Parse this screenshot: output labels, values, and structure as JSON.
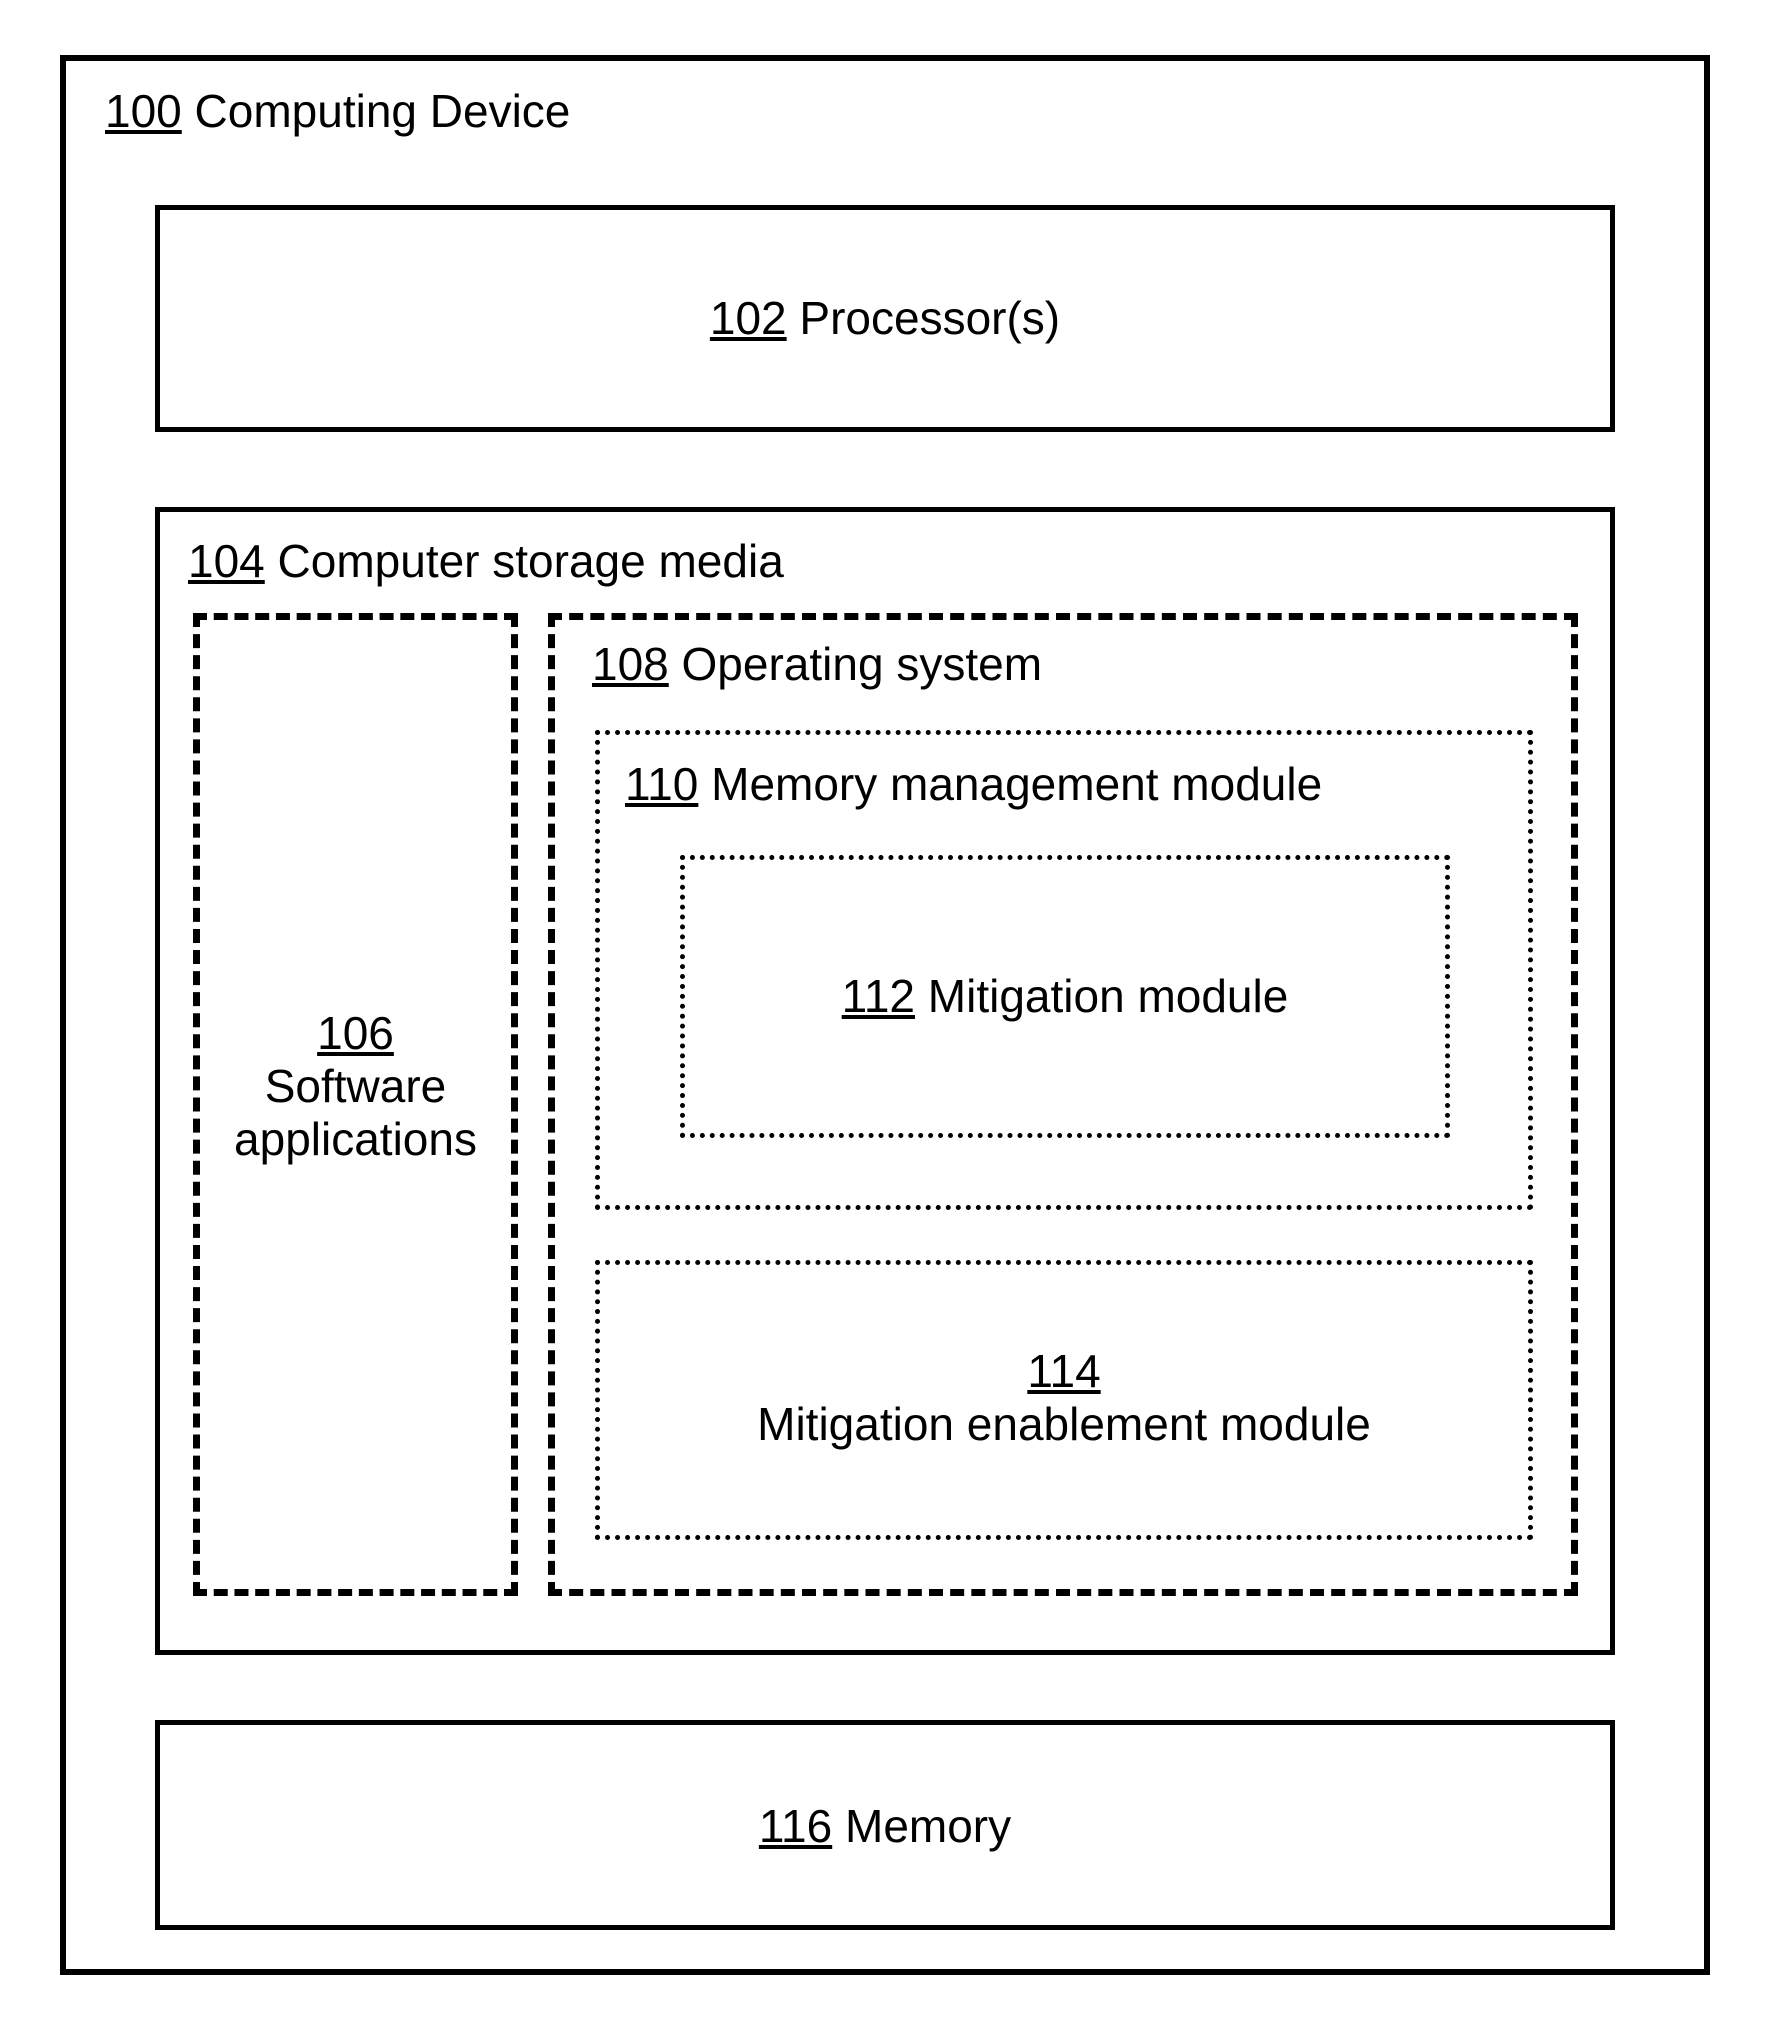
{
  "device": {
    "ref": "100",
    "name": "Computing Device"
  },
  "processor": {
    "ref": "102",
    "name": "Processor(s)"
  },
  "storage": {
    "ref": "104",
    "name": "Computer storage media"
  },
  "software": {
    "ref": "106",
    "name": "Software",
    "name2": "applications"
  },
  "os": {
    "ref": "108",
    "name": "Operating system"
  },
  "memmgr": {
    "ref": "110",
    "name": "Memory management module"
  },
  "mitigation": {
    "ref": "112",
    "name": "Mitigation module"
  },
  "mit_enable": {
    "ref": "114",
    "name": "Mitigation enablement module"
  },
  "memory": {
    "ref": "116",
    "name": "Memory"
  }
}
